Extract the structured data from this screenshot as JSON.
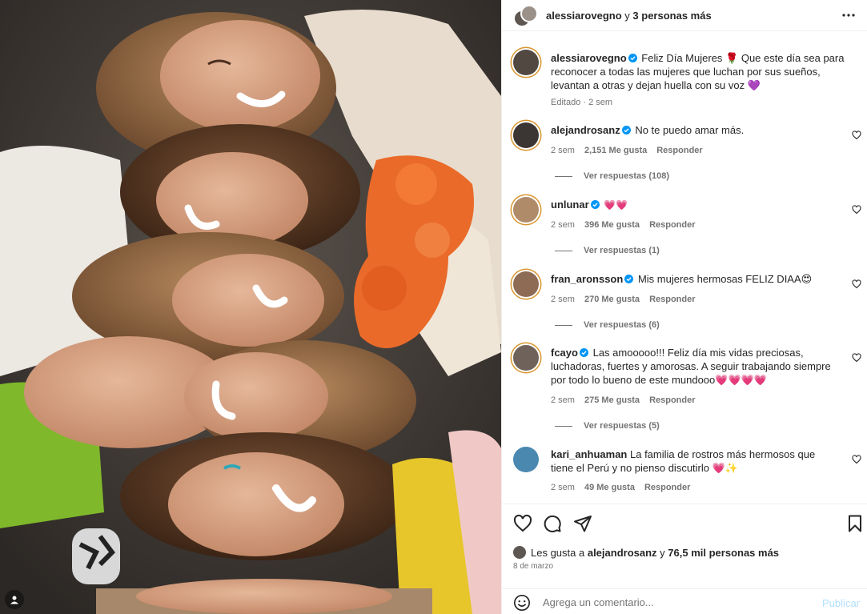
{
  "post": {
    "header": {
      "username": "alessiarovegno",
      "conjunction": "y",
      "others": "3 personas más"
    },
    "caption": {
      "username": "alessiarovegno",
      "text": "Feliz Día Mujeres 🌹 Que este día sea para reconocer a todas las mujeres que luchan por sus sueños, levantan a otras y dejan huella con su voz 💜",
      "meta": "Editado · 2 sem"
    },
    "comments": [
      {
        "username": "alejandrosanz",
        "verified": true,
        "text": "No te puedo amar más.",
        "time": "2 sem",
        "likes": "2,151 Me gusta",
        "reply": "Responder",
        "replies": "Ver respuestas (108)"
      },
      {
        "username": "unlunar",
        "verified": true,
        "text": "💗💗",
        "time": "2 sem",
        "likes": "396 Me gusta",
        "reply": "Responder",
        "replies": "Ver respuestas (1)"
      },
      {
        "username": "fran_aronsson",
        "verified": true,
        "text": "Mis mujeres hermosas FELIZ DIAA😍",
        "time": "2 sem",
        "likes": "270 Me gusta",
        "reply": "Responder",
        "replies": "Ver respuestas (6)"
      },
      {
        "username": "fcayo",
        "verified": true,
        "text": "Las amooooo!!! Feliz día mis vidas preciosas, luchadoras, fuertes y amorosas. A seguir trabajando siempre por todo lo bueno de este mundooo💗💗💗💗",
        "time": "2 sem",
        "likes": "275 Me gusta",
        "reply": "Responder",
        "replies": "Ver respuestas (5)"
      },
      {
        "username": "kari_anhuaman",
        "verified": false,
        "text": "La familia de rostros más hermosos que tiene el Perú y no pienso discutirlo 💗✨",
        "time": "2 sem",
        "likes": "49 Me gusta",
        "reply": "Responder"
      }
    ],
    "likes": {
      "prefix": "Les gusta a",
      "user": "alejandrosanz",
      "conj": "y",
      "others": "76,5 mil personas más"
    },
    "date": "8 de marzo",
    "comment_box": {
      "placeholder": "Agrega un comentario...",
      "publish": "Publicar"
    }
  },
  "icons": {
    "more": "more-horizontal-icon",
    "like": "heart-outline-icon",
    "comment": "comment-bubble-icon",
    "share": "paper-plane-icon",
    "save": "bookmark-icon",
    "emoji": "smiley-icon",
    "verified": "verified-badge-icon"
  },
  "colors": {
    "text": "#262626",
    "secondary": "#737373",
    "verified": "#0095f6",
    "publish_disabled": "#b2dffc",
    "border": "#efefef"
  }
}
